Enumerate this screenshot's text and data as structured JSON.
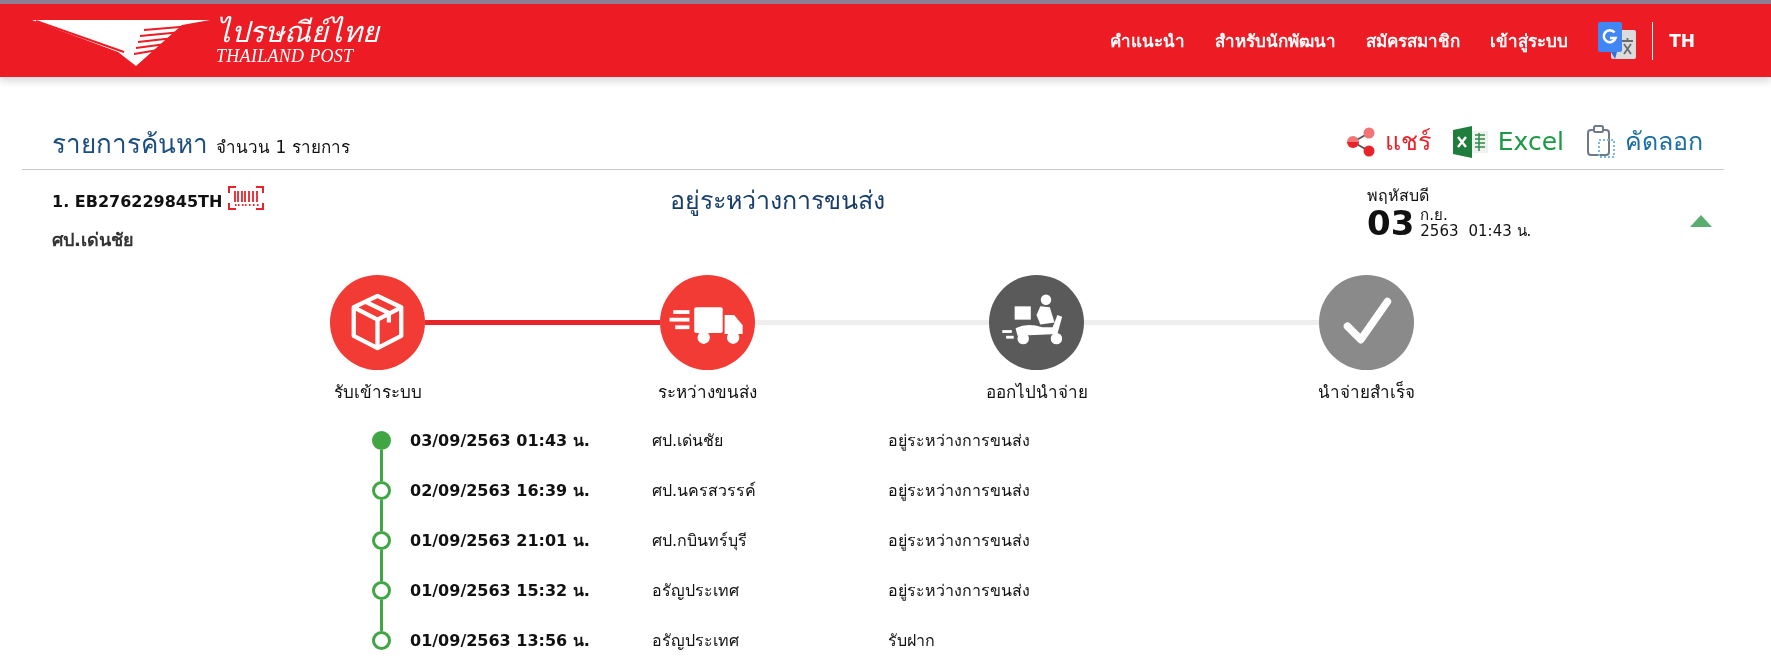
{
  "header": {
    "logo": {
      "name": "ไปรษณีย์ไทย",
      "subtitle": "THAILAND POST"
    },
    "nav": [
      "คำแนะนำ",
      "สำหรับนักพัฒนา",
      "สมัครสมาชิก",
      "เข้าสู่ระบบ"
    ],
    "language": "TH"
  },
  "results": {
    "title": "รายการค้นหา",
    "count": "จำนวน 1 รายการ",
    "actions": [
      {
        "kind": "share",
        "label": "แชร์"
      },
      {
        "kind": "excel",
        "label": "Excel"
      },
      {
        "kind": "copy",
        "label": "คัดลอก"
      }
    ]
  },
  "item": {
    "tracking": "1. EB276229845TH",
    "office": "ศป.เด่นชัย",
    "status": "อยู่ระหว่างการขนส่ง",
    "date": {
      "weekday": "พฤหัสบดี",
      "day": "03",
      "month": "ก.ย.",
      "year": "2563",
      "time": "01:43 น."
    },
    "expanded": true,
    "steps": [
      {
        "kind": "received",
        "label": "รับเข้าระบบ",
        "reached": true
      },
      {
        "kind": "transit",
        "label": "ระหว่างขนส่ง",
        "reached": true
      },
      {
        "kind": "delivering",
        "label": "ออกไปนำจ่าย",
        "reached": false
      },
      {
        "kind": "delivered",
        "label": "นำจ่ายสำเร็จ",
        "reached": false
      }
    ],
    "events": [
      {
        "datetime": "03/09/2563 01:43 น.",
        "location": "ศป.เด่นชัย",
        "status": "อยู่ระหว่างการขนส่ง",
        "current": true
      },
      {
        "datetime": "02/09/2563 16:39 น.",
        "location": "ศป.นครสวรรค์",
        "status": "อยู่ระหว่างการขนส่ง",
        "current": false
      },
      {
        "datetime": "01/09/2563 21:01 น.",
        "location": "ศป.กบินทร์บุรี",
        "status": "อยู่ระหว่างการขนส่ง",
        "current": false
      },
      {
        "datetime": "01/09/2563 15:32 น.",
        "location": "อรัญประเทศ",
        "status": "อยู่ระหว่างการขนส่ง",
        "current": false
      },
      {
        "datetime": "01/09/2563 13:56 น.",
        "location": "อรัญประเทศ",
        "status": "รับฝาก",
        "current": false
      }
    ]
  }
}
